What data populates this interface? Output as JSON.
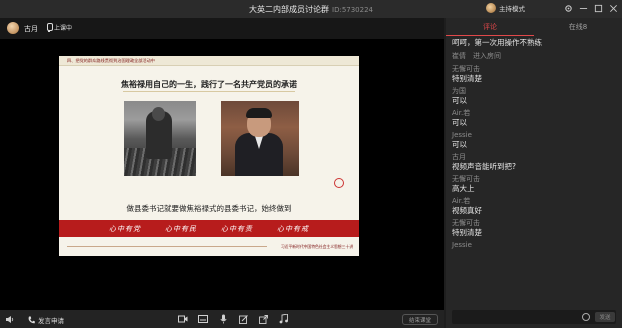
{
  "window": {
    "title": "大英二内部成员讨论群",
    "room_id": "ID:5730224",
    "host_mode_label": "主持模式"
  },
  "video": {
    "user_name": "古月",
    "mic_status": "上课中"
  },
  "slide": {
    "section_title": "四、把党的群众路线贯彻到治国理政全部活动中",
    "headline": "焦裕禄用自己的一生，践行了一名共产党员的承诺",
    "caption": "做县委书记就要做焦裕禄式的县委书记，始终做到",
    "banner": [
      "心中有党",
      "心中有民",
      "心中有责",
      "心中有戒"
    ],
    "footer": "习近平新时代中国特色社会主义思想三十讲"
  },
  "toolbar": {
    "speak_label": "发言申请",
    "end_label": "结束课堂",
    "icons": [
      "video-camera-icon",
      "subtitle-icon",
      "microphone-icon",
      "edit-icon",
      "share-icon",
      "music-icon"
    ]
  },
  "chat": {
    "tabs": [
      "评论",
      "在线8"
    ],
    "messages": [
      {
        "name": "",
        "text": "呵呵，第一次用操作不熟练"
      },
      {
        "system": "崔倩　进入房间"
      },
      {
        "name": "无懈可击",
        "text": "特别清楚"
      },
      {
        "name": "为国",
        "text": "可以"
      },
      {
        "name": "Air.若",
        "text": "可以"
      },
      {
        "name": "Jessie",
        "text": "可以"
      },
      {
        "name": "古月",
        "text": "视频声音能听到把?"
      },
      {
        "name": "无懈可击",
        "text": "高大上"
      },
      {
        "name": "Air.若",
        "text": "视频真好"
      },
      {
        "name": "无懈可击",
        "text": "特别清楚"
      },
      {
        "name": "Jessie",
        "text": ""
      }
    ],
    "send_label": "发送"
  }
}
